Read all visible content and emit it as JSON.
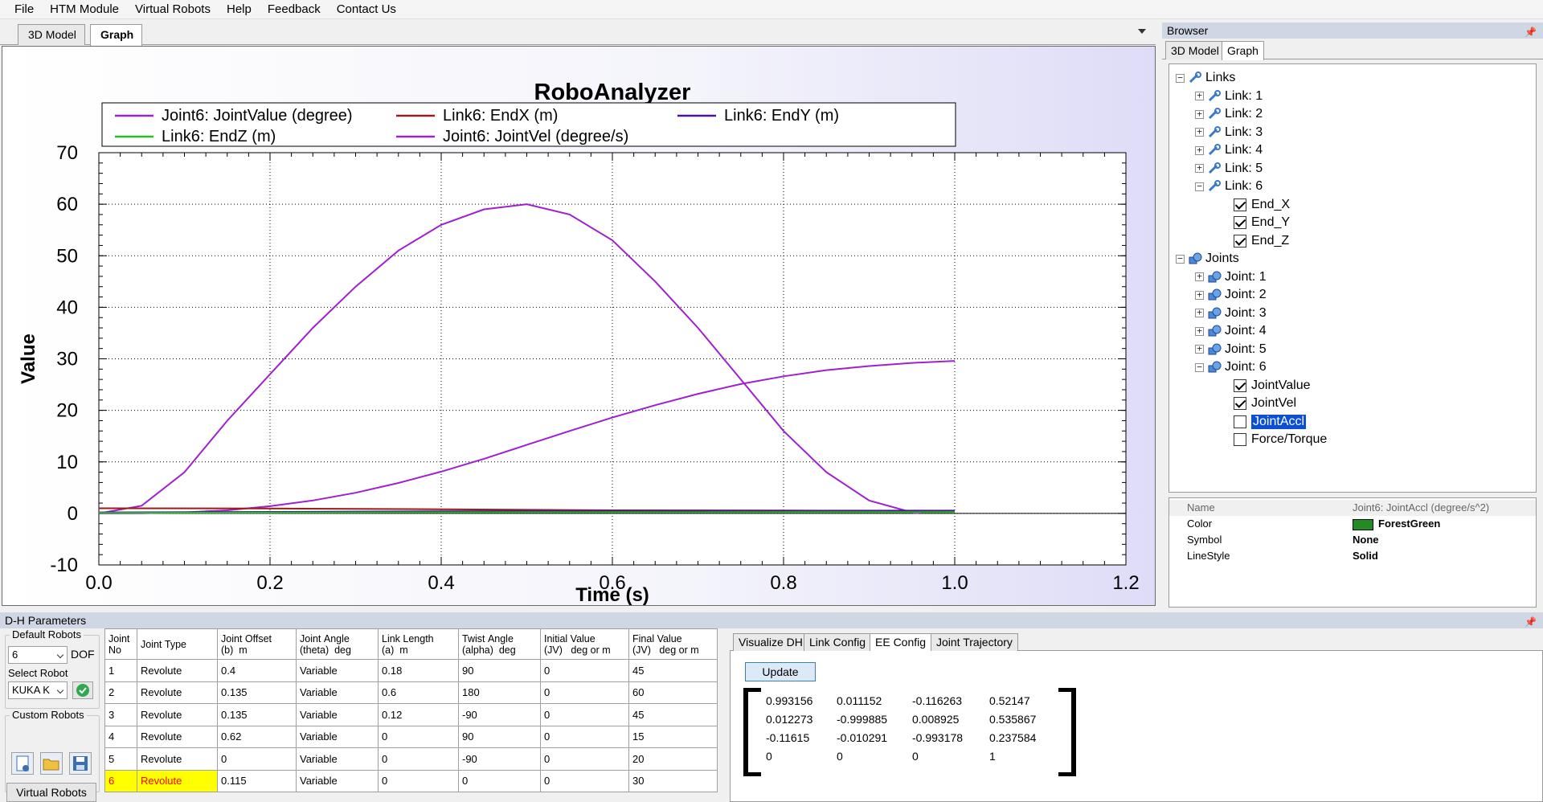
{
  "menu": [
    "File",
    "HTM Module",
    "Virtual Robots",
    "Help",
    "Feedback",
    "Contact Us"
  ],
  "doc_tabs": [
    "3D Model",
    "Graph"
  ],
  "colors": {
    "purple": "#a020d0",
    "indigo": "#5010a0",
    "darkred": "#9b1b1b",
    "green": "#22c022",
    "forestgreen": "#228b22",
    "selection": "#0a4fd6"
  },
  "chart_data": {
    "type": "line",
    "title": "RoboAnalyzer",
    "xlabel": "Time (s)",
    "ylabel": "Value",
    "xlim": [
      0,
      1.2
    ],
    "ylim": [
      -10,
      70
    ],
    "x_ticks": [
      "0.0",
      "0.2",
      "0.4",
      "0.6",
      "0.8",
      "1.0",
      "1.2"
    ],
    "y_ticks": [
      "70",
      "60",
      "50",
      "40",
      "30",
      "20",
      "10",
      "0",
      "-10"
    ],
    "grid": true,
    "legend_position": "top",
    "legend": [
      {
        "name": "Joint6: JointValue (degree)",
        "color": "#a020d0"
      },
      {
        "name": "Link6: EndX (m)",
        "color": "#9b1b1b"
      },
      {
        "name": "Link6: EndY (m)",
        "color": "#5010a0"
      },
      {
        "name": "Link6: EndZ (m)",
        "color": "#22c022"
      },
      {
        "name": "Joint6: JointVel (degree/s)",
        "color": "#a020d0"
      }
    ],
    "series": [
      {
        "name": "Joint6: JointValue (degree)",
        "color": "#a020d0",
        "x": [
          0,
          0.05,
          0.1,
          0.15,
          0.2,
          0.25,
          0.3,
          0.35,
          0.4,
          0.45,
          0.5,
          0.55,
          0.6,
          0.65,
          0.7,
          0.75,
          0.8,
          0.85,
          0.9,
          0.95,
          1.0
        ],
        "y": [
          0,
          0.03,
          0.2,
          0.6,
          1.4,
          2.5,
          4.0,
          5.9,
          8.1,
          10.6,
          13.3,
          16.0,
          18.6,
          21.0,
          23.2,
          25.1,
          26.6,
          27.8,
          28.6,
          29.2,
          29.6
        ]
      },
      {
        "name": "Joint6: JointVel (degree/s)",
        "color": "#a020d0",
        "x": [
          0,
          0.05,
          0.1,
          0.15,
          0.2,
          0.25,
          0.3,
          0.35,
          0.4,
          0.45,
          0.5,
          0.55,
          0.6,
          0.65,
          0.7,
          0.75,
          0.8,
          0.85,
          0.9,
          0.95,
          0.96
        ],
        "y": [
          0,
          1.5,
          8,
          18,
          27,
          36,
          44,
          51,
          56,
          59,
          60,
          58,
          53,
          45,
          36,
          26,
          16,
          8,
          2.5,
          0.2,
          0
        ]
      },
      {
        "name": "Link6: EndX (m)",
        "color": "#9b1b1b",
        "x": [
          0,
          0.2,
          0.4,
          0.6,
          0.8,
          1.0
        ],
        "y": [
          1.0,
          0.95,
          0.8,
          0.6,
          0.55,
          0.52
        ]
      },
      {
        "name": "Link6: EndY (m)",
        "color": "#5010a0",
        "x": [
          0,
          0.2,
          0.4,
          0.6,
          0.8,
          1.0
        ],
        "y": [
          0.2,
          0.3,
          0.4,
          0.5,
          0.52,
          0.54
        ]
      },
      {
        "name": "Link6: EndZ (m)",
        "color": "#22c022",
        "x": [
          0,
          0.2,
          0.4,
          0.6,
          0.8,
          1.0
        ],
        "y": [
          0.1,
          0.15,
          0.2,
          0.22,
          0.23,
          0.24
        ]
      }
    ]
  },
  "browser": {
    "title": "Browser",
    "tabs": [
      "3D Model",
      "Graph"
    ],
    "tree": {
      "links_label": "Links",
      "links": [
        "Link: 1",
        "Link: 2",
        "Link: 3",
        "Link: 4",
        "Link: 5",
        "Link: 6"
      ],
      "link6_children": [
        {
          "label": "End_X",
          "checked": true
        },
        {
          "label": "End_Y",
          "checked": true
        },
        {
          "label": "End_Z",
          "checked": true
        }
      ],
      "joints_label": "Joints",
      "joints": [
        "Joint: 1",
        "Joint: 2",
        "Joint: 3",
        "Joint: 4",
        "Joint: 5",
        "Joint: 6"
      ],
      "joint6_children": [
        {
          "label": "JointValue",
          "checked": true
        },
        {
          "label": "JointVel",
          "checked": true
        },
        {
          "label": "JointAccl",
          "checked": false,
          "selected": true
        },
        {
          "label": "Force/Torque",
          "checked": false
        }
      ]
    },
    "properties": {
      "name_label": "Name",
      "name_value": "Joint6: JointAccl (degree/s^2)",
      "color_label": "Color",
      "color_value": "ForestGreen",
      "symbol_label": "Symbol",
      "symbol_value": "None",
      "linestyle_label": "LineStyle",
      "linestyle_value": "Solid"
    }
  },
  "dh": {
    "title": "D-H Parameters",
    "default_robots_label": "Default Robots",
    "dof_value": "6",
    "dof_label": "DOF",
    "select_robot_label": "Select Robot",
    "robot_value": "KUKA K",
    "custom_robots_label": "Custom Robots",
    "virtual_robots_button": "Virtual Robots",
    "columns": [
      "Joint\nNo",
      "Joint Type",
      "Joint Offset\n(b)  m",
      "Joint Angle\n(theta)  deg",
      "Link Length\n(a)  m",
      "Twist Angle\n(alpha)  deg",
      "Initial Value\n(JV)   deg or m",
      "Final Value\n(JV)   deg or m"
    ],
    "rows": [
      [
        "1",
        "Revolute",
        "0.4",
        "Variable",
        "0.18",
        "90",
        "0",
        "45"
      ],
      [
        "2",
        "Revolute",
        "0.135",
        "Variable",
        "0.6",
        "180",
        "0",
        "60"
      ],
      [
        "3",
        "Revolute",
        "0.135",
        "Variable",
        "0.12",
        "-90",
        "0",
        "45"
      ],
      [
        "4",
        "Revolute",
        "0.62",
        "Variable",
        "0",
        "90",
        "0",
        "15"
      ],
      [
        "5",
        "Revolute",
        "0",
        "Variable",
        "0",
        "-90",
        "0",
        "20"
      ],
      [
        "6",
        "Revolute",
        "0.115",
        "Variable",
        "0",
        "0",
        "0",
        "30"
      ]
    ]
  },
  "ee": {
    "tabs": [
      "Visualize DH",
      "Link Config",
      "EE Config",
      "Joint Trajectory"
    ],
    "update_button": "Update",
    "matrix": [
      [
        "0.993156",
        "0.011152",
        "-0.116263",
        "0.52147"
      ],
      [
        "0.012273",
        "-0.999885",
        "0.008925",
        "0.535867"
      ],
      [
        "-0.11615",
        "-0.010291",
        "-0.993178",
        "0.237584"
      ],
      [
        "0",
        "0",
        "0",
        "1"
      ]
    ]
  }
}
